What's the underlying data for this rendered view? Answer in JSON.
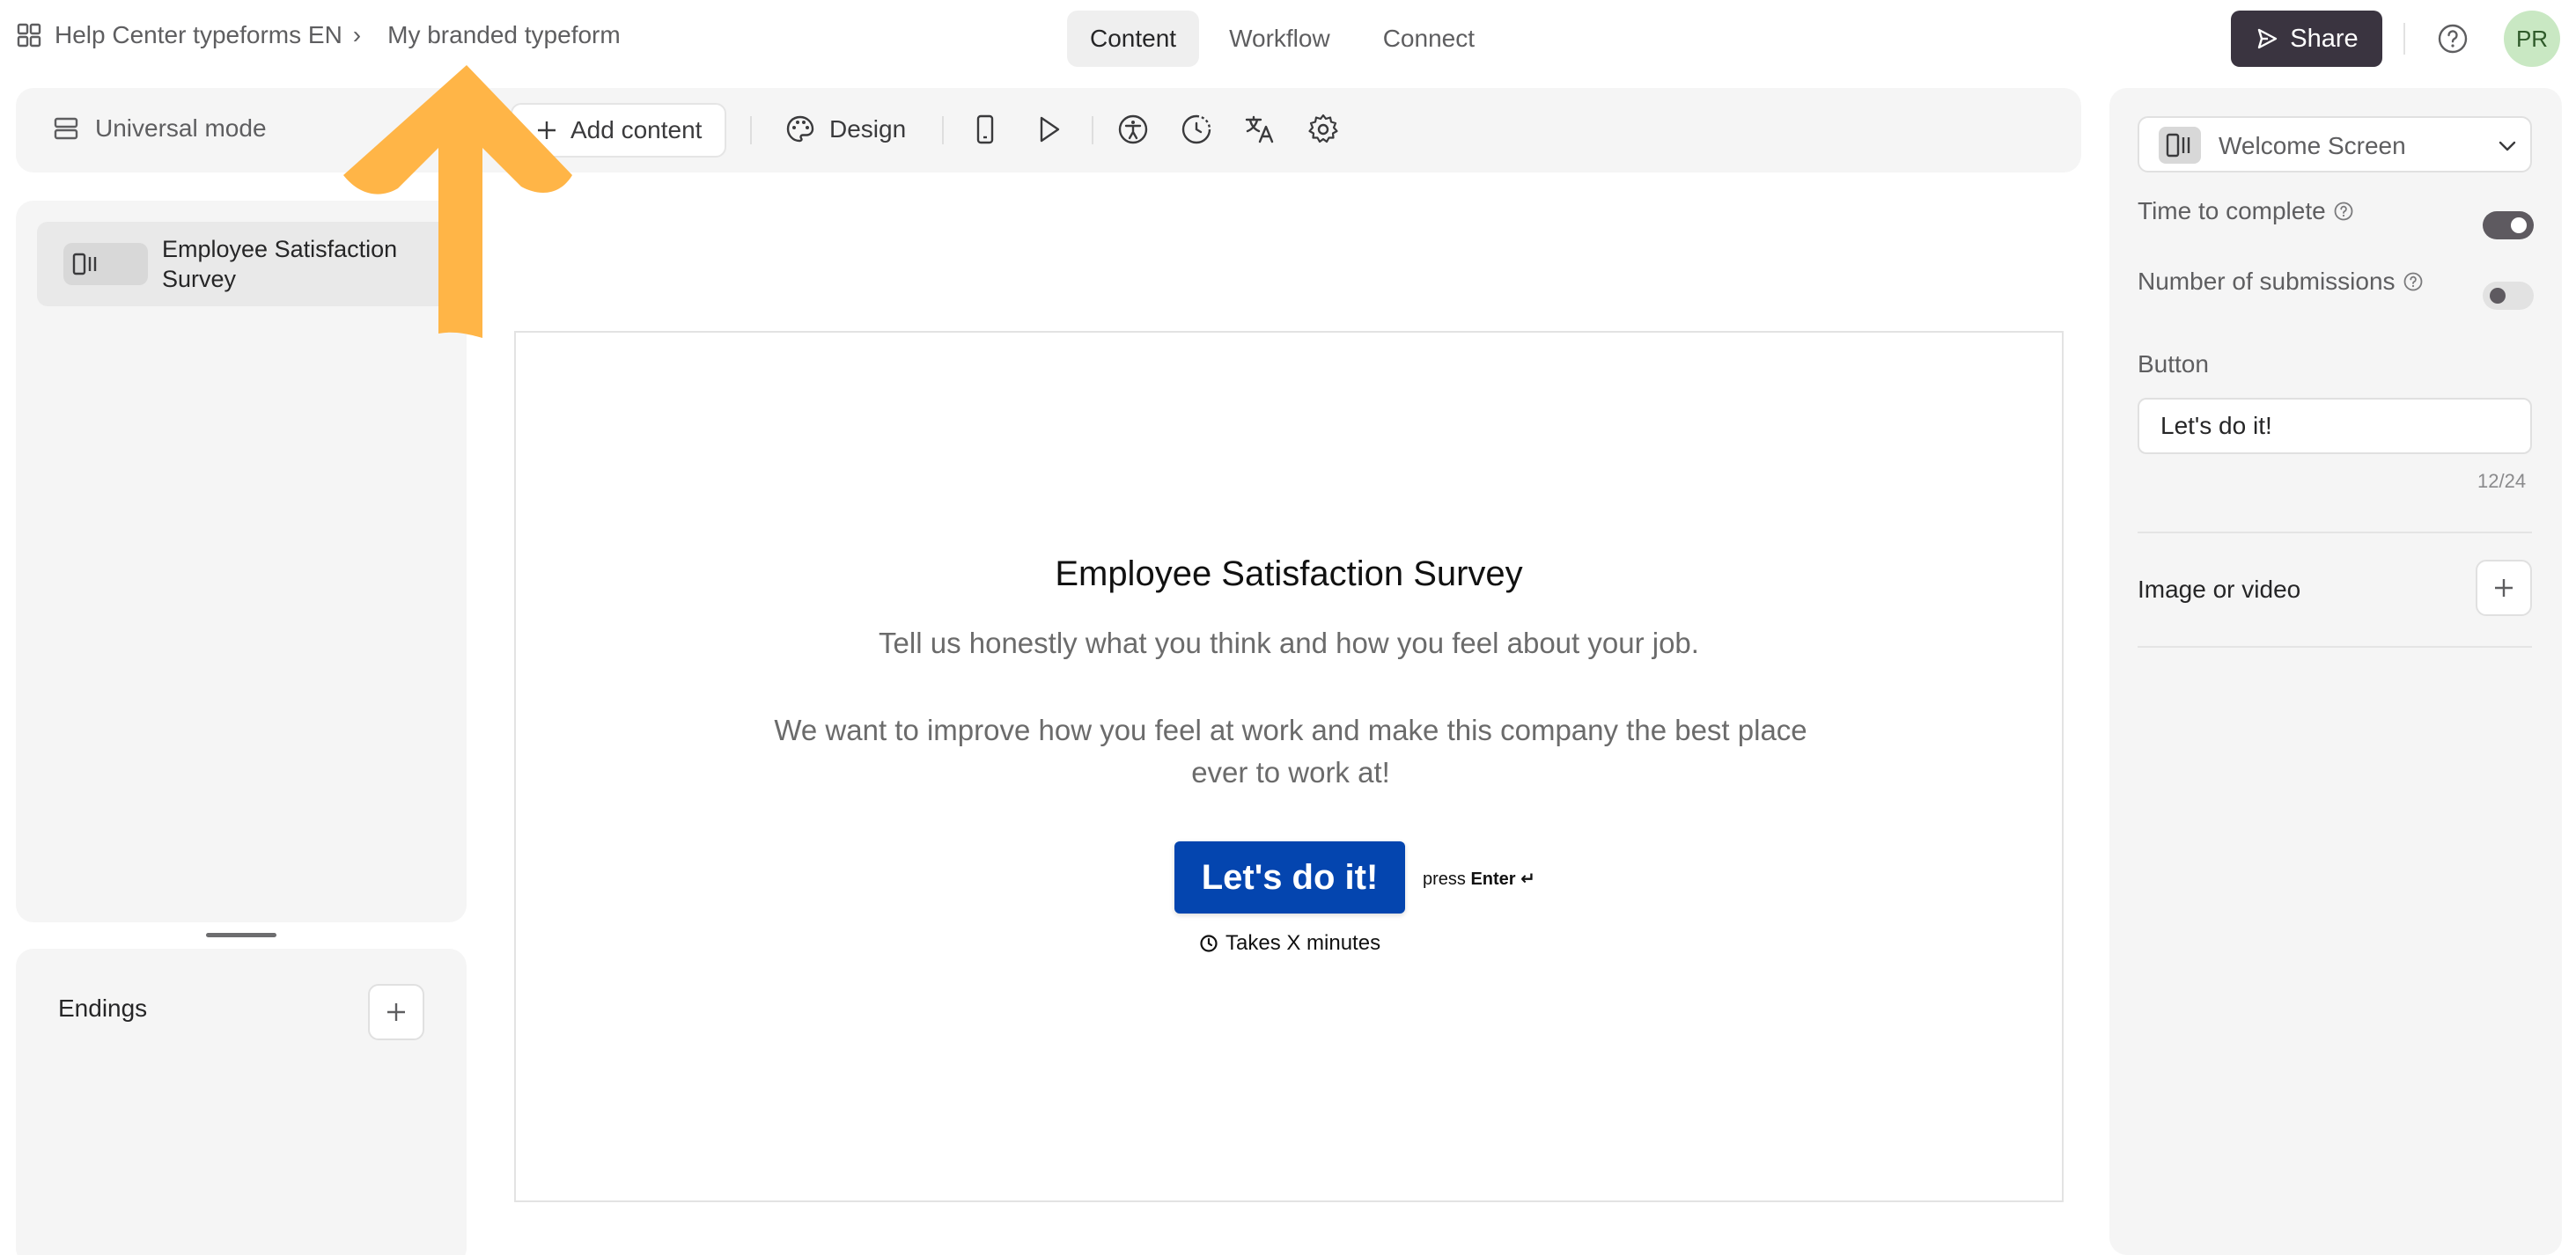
{
  "topbar": {
    "breadcrumb_workspace": "Help Center typeforms EN",
    "breadcrumb_separator": "›",
    "breadcrumb_form": "My branded typeform",
    "tabs": [
      {
        "label": "Content"
      },
      {
        "label": "Workflow"
      },
      {
        "label": "Connect"
      }
    ],
    "share_label": "Share",
    "avatar_initials": "PR"
  },
  "toolbar": {
    "mode_label": "Universal mode",
    "add_content_label": "Add content",
    "design_label": "Design"
  },
  "left_panel": {
    "question_title": "Employee Satisfaction Survey",
    "endings_label": "Endings"
  },
  "canvas": {
    "title": "Employee Satisfaction Survey",
    "description_1": "Tell us honestly what you think and how you feel about your job.",
    "description_2": "We want to improve how you feel at work and make this company the best place ever to work at!",
    "button_label": "Let's do it!",
    "press_label": "press",
    "enter_label": "Enter ↵",
    "time_label": "Takes X minutes"
  },
  "right_panel": {
    "screen_select_label": "Welcome Screen",
    "time_to_complete_label": "Time to complete",
    "time_to_complete_on": true,
    "number_of_submissions_label": "Number of submissions",
    "number_of_submissions_on": false,
    "button_section_label": "Button",
    "button_text_value": "Let's do it!",
    "char_count": "12/24",
    "image_or_video_label": "Image or video"
  },
  "colors": {
    "accent": "#0445af",
    "share_bg": "#3a3440",
    "annotation_arrow": "#ffb547"
  }
}
